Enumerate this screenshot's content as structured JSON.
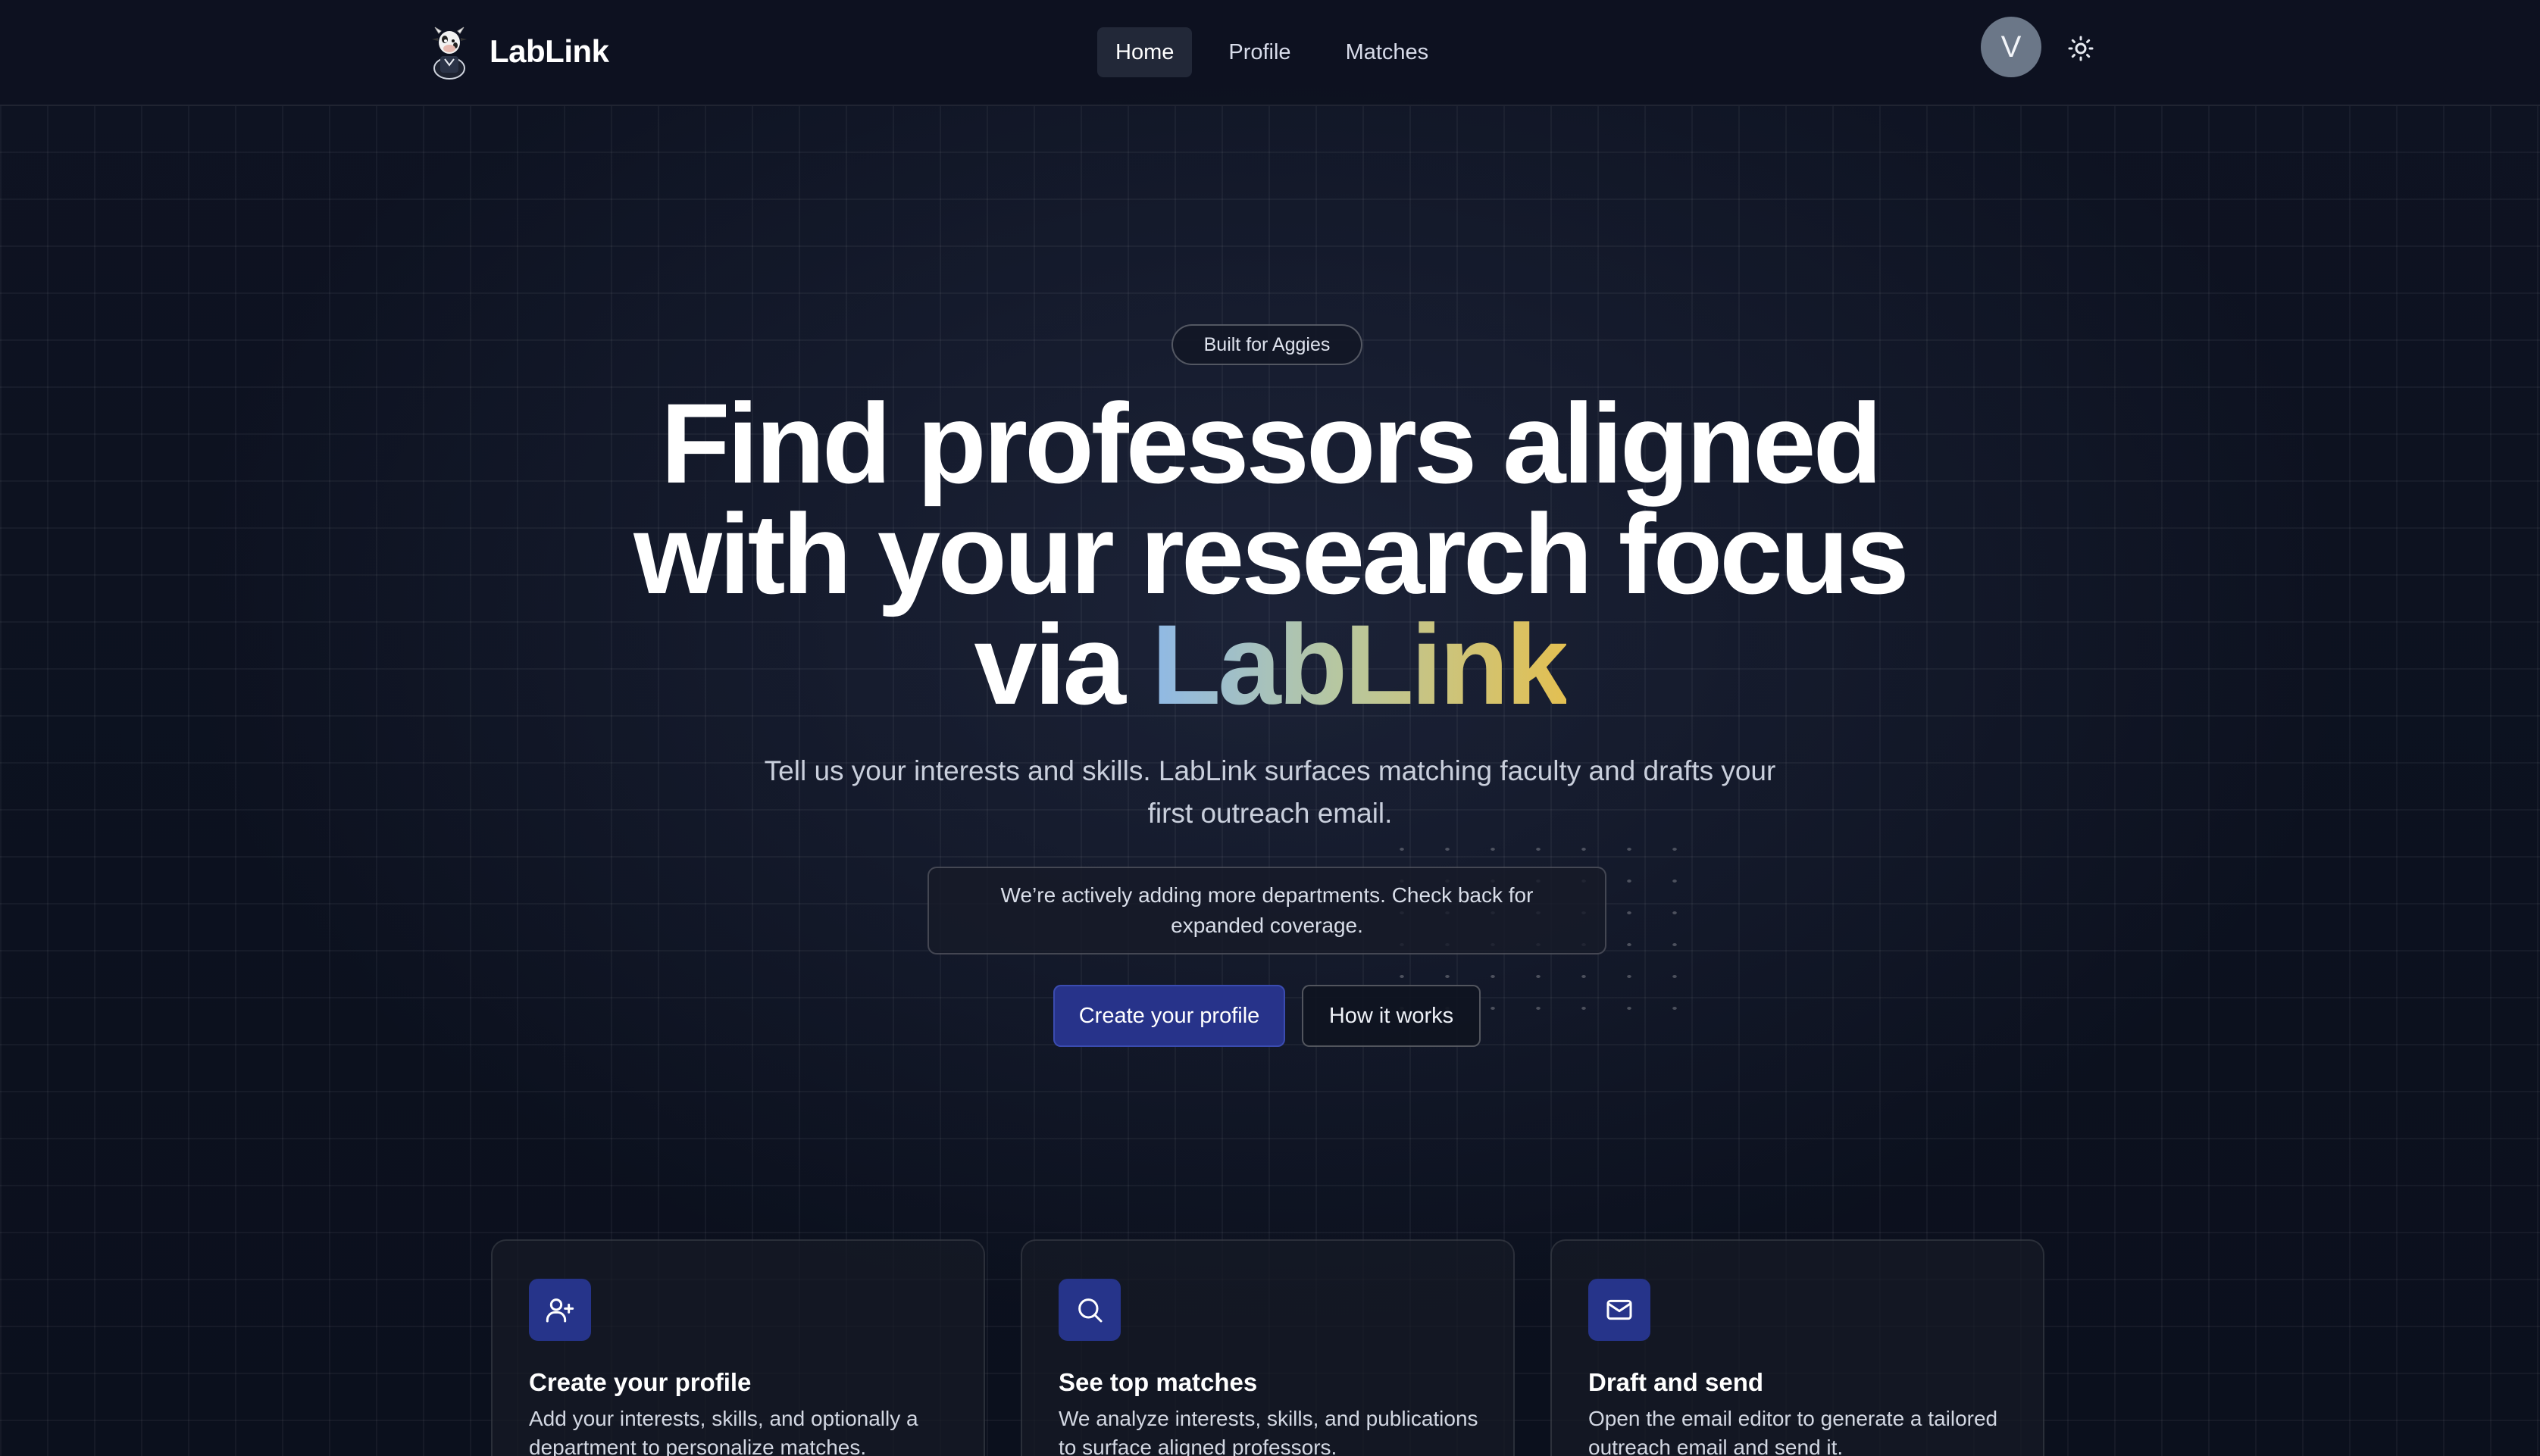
{
  "header": {
    "brand_name": "LabLink",
    "nav": {
      "home": "Home",
      "profile": "Profile",
      "matches": "Matches"
    },
    "avatar_initial": "V"
  },
  "hero": {
    "badge": "Built for Aggies",
    "title_line1": "Find professors aligned",
    "title_line2": "with your research focus",
    "title_line3_prefix": "via ",
    "title_highlight": "LabLink",
    "subtitle": "Tell us your interests and skills. LabLink surfaces matching faculty and drafts your first outreach email.",
    "notice": "We’re actively adding more departments. Check back for expanded coverage.",
    "primary_cta": "Create your profile",
    "secondary_cta": "How it works"
  },
  "features": [
    {
      "icon": "user-plus-icon",
      "title": "Create your profile",
      "description": "Add your interests, skills, and optionally a department to personalize matches."
    },
    {
      "icon": "search-icon",
      "title": "See top matches",
      "description": "We analyze interests, skills, and publications to surface aligned professors."
    },
    {
      "icon": "mail-icon",
      "title": "Draft and send",
      "description": "Open the email editor to generate a tailored outreach email and send it."
    }
  ],
  "colors": {
    "accent": "#27338a",
    "gradient_start": "#8fb9e6",
    "gradient_end": "#e3c052",
    "background": "#0b1020"
  }
}
